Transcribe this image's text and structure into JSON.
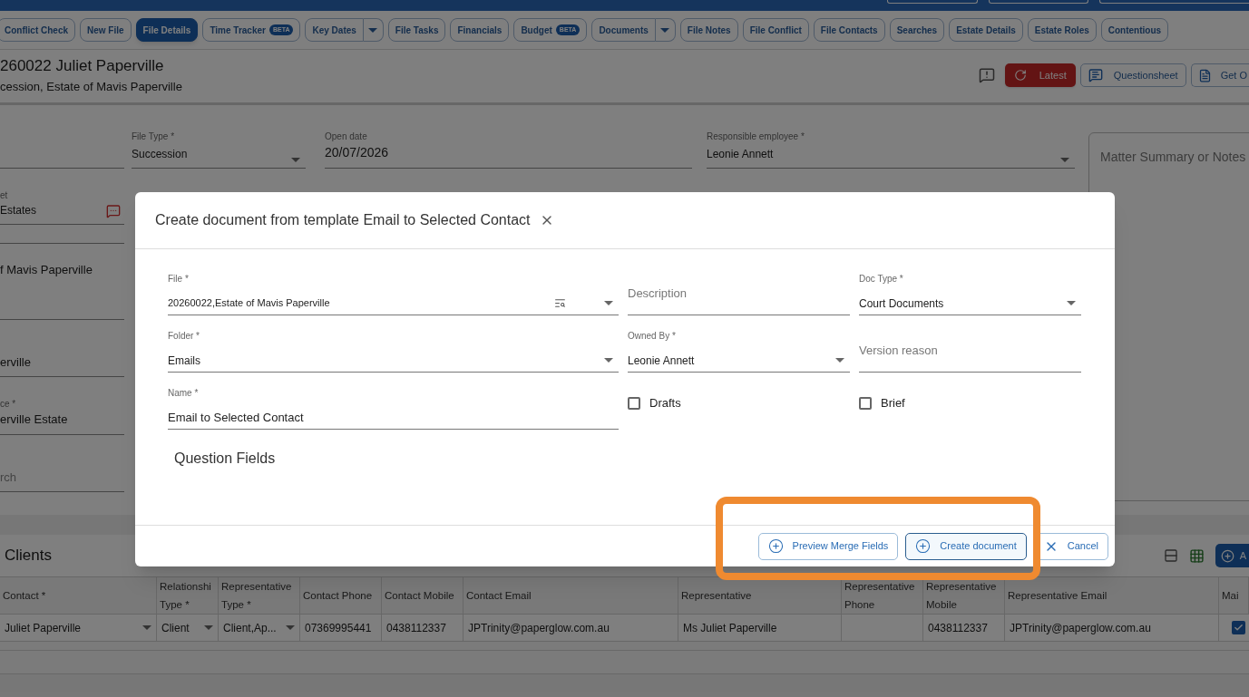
{
  "tabs": [
    {
      "label": "Conflict Check",
      "kind": "plain",
      "selected": false
    },
    {
      "label": "New File",
      "kind": "plain",
      "selected": false
    },
    {
      "label": "File Details",
      "kind": "plain",
      "selected": true
    },
    {
      "label": "Time Tracker",
      "kind": "plain",
      "badge": "BETA",
      "selected": false
    },
    {
      "label": "Key Dates",
      "kind": "split",
      "selected": false
    },
    {
      "label": "File Tasks",
      "kind": "plain",
      "selected": false
    },
    {
      "label": "Financials",
      "kind": "plain",
      "selected": false
    },
    {
      "label": "Budget",
      "kind": "plain",
      "badge": "BETA",
      "selected": false
    },
    {
      "label": "Documents",
      "kind": "split",
      "selected": false
    },
    {
      "label": "File Notes",
      "kind": "plain",
      "selected": false
    },
    {
      "label": "File Conflict",
      "kind": "plain",
      "selected": false
    },
    {
      "label": "File Contacts",
      "kind": "plain",
      "selected": false
    },
    {
      "label": "Searches",
      "kind": "plain",
      "selected": false
    },
    {
      "label": "Estate Details",
      "kind": "plain",
      "selected": false
    },
    {
      "label": "Estate Roles",
      "kind": "plain",
      "selected": false
    },
    {
      "label": "Contentious",
      "kind": "plain",
      "selected": false
    }
  ],
  "file_header": {
    "title": "260022 Juliet Paperville",
    "subtitle": "cession, Estate of Mavis Paperville",
    "actions": [
      {
        "kind": "alert"
      },
      {
        "label": "Latest",
        "kind": "refresh"
      },
      {
        "label": "Questionsheet",
        "kind": "chat"
      },
      {
        "label": "Get O",
        "kind": "document"
      }
    ]
  },
  "details": {
    "file_type": {
      "label": "File Type *",
      "value": "Succession"
    },
    "open_date": {
      "label": "Open date",
      "value": "20/07/2026"
    },
    "responsible_employee": {
      "label": "Responsible employee *",
      "value": "Leonie Annett"
    },
    "field_2": {
      "label": "et",
      "value": "Estates"
    },
    "field_3": {
      "value": "f Mavis Paperville"
    },
    "field_4": {
      "value": "erville"
    },
    "field_5": {
      "label": "ce *",
      "value": "erville Estate"
    },
    "field_6": {
      "placeholder": "rch"
    },
    "notes": {
      "placeholder": "Matter Summary or Notes"
    }
  },
  "clients": {
    "title": "Clients",
    "add_button": "A",
    "columns": [
      {
        "label": "Contact *",
        "kind": "select"
      },
      {
        "label": "Relationshi Type *",
        "kind": "select"
      },
      {
        "label": "Representative Type *",
        "kind": "select"
      },
      {
        "label": "Contact Phone",
        "kind": "text"
      },
      {
        "label": "Contact Mobile",
        "kind": "text"
      },
      {
        "label": "Contact Email",
        "kind": "text"
      },
      {
        "label": "Representative",
        "kind": "text"
      },
      {
        "label": "Representative Phone",
        "kind": "text"
      },
      {
        "label": "Representative Mobile",
        "kind": "text"
      },
      {
        "label": "Representative Email",
        "kind": "text"
      },
      {
        "label": "Mai",
        "kind": "check"
      }
    ],
    "rows": [
      {
        "cells": [
          "Juliet Paperville",
          "Client",
          "Client,Ap...",
          "07369995441",
          "0438112337",
          "JPTrinity@paperglow.com.au",
          "Ms Juliet Paperville",
          null,
          "0438112337",
          "JPTrinity@paperglow.com.au"
        ],
        "main": true
      }
    ]
  },
  "dialog": {
    "title": "Create document from template Email to Selected Contact",
    "fields": [
      {
        "label": "File *",
        "value": "20260022,Estate of Mavis Paperville",
        "kind": "lookup"
      },
      {
        "placeholder": "Description",
        "kind": "text"
      },
      {
        "label": "Doc Type *",
        "value": "Court Documents",
        "kind": "select"
      },
      {
        "label": "Folder *",
        "value": "Emails",
        "kind": "select"
      },
      {
        "label": "Owned By *",
        "value": "Leonie Annett",
        "kind": "select"
      },
      {
        "placeholder": "Version reason",
        "kind": "text"
      },
      {
        "label": "Name *",
        "value": "Email to Selected Contact",
        "kind": "text"
      },
      {
        "label": "Drafts",
        "checked": false,
        "kind": "checkbox"
      },
      {
        "label": "Brief",
        "checked": false,
        "kind": "checkbox"
      }
    ],
    "section_title": "Question Fields",
    "buttons": [
      {
        "label": "Preview Merge Fields",
        "kind": "add",
        "focused": false
      },
      {
        "label": "Create document",
        "kind": "add",
        "focused": true
      },
      {
        "label": "Cancel",
        "kind": "cancel",
        "focused": false
      }
    ]
  }
}
